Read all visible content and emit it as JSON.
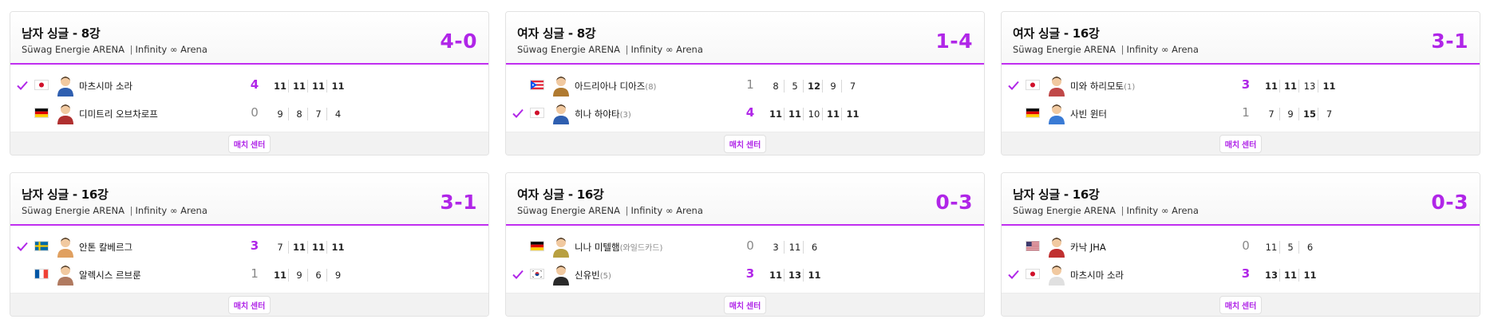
{
  "colors": {
    "accent": "#b026e8",
    "check": "#b026e8"
  },
  "match_center_label": "매치 센터",
  "matches": [
    {
      "title": "남자 싱글 - 8강",
      "venue": "Süwag Energie ARENA",
      "table": "Infinity ∞ Arena",
      "score": "4-0",
      "players": [
        {
          "name": "마츠시마 소라",
          "seed": "",
          "flag": "JPN",
          "winner": true,
          "sets": "4",
          "games": [
            "11",
            "11",
            "11",
            "11"
          ],
          "bold": [
            true,
            true,
            true,
            true
          ]
        },
        {
          "name": "디미트리 오브차로프",
          "seed": "",
          "flag": "GER",
          "winner": false,
          "sets": "0",
          "games": [
            "9",
            "8",
            "7",
            "4"
          ],
          "bold": [
            false,
            false,
            false,
            false
          ]
        }
      ]
    },
    {
      "title": "여자 싱글 - 8강",
      "venue": "Süwag Energie ARENA",
      "table": "Infinity ∞ Arena",
      "score": "1-4",
      "players": [
        {
          "name": "아드리아나 디아즈",
          "seed": "(8)",
          "flag": "PUR",
          "winner": false,
          "sets": "1",
          "games": [
            "8",
            "5",
            "12",
            "9",
            "7"
          ],
          "bold": [
            false,
            false,
            true,
            false,
            false
          ]
        },
        {
          "name": "히나 하야타",
          "seed": "(3)",
          "flag": "JPN",
          "winner": true,
          "sets": "4",
          "games": [
            "11",
            "11",
            "10",
            "11",
            "11"
          ],
          "bold": [
            true,
            true,
            false,
            true,
            true
          ]
        }
      ]
    },
    {
      "title": "여자 싱글 - 16강",
      "venue": "Süwag Energie ARENA",
      "table": "Infinity ∞ Arena",
      "score": "3-1",
      "players": [
        {
          "name": "미와 하리모토",
          "seed": "(1)",
          "flag": "JPN",
          "winner": true,
          "sets": "3",
          "games": [
            "11",
            "11",
            "13",
            "11"
          ],
          "bold": [
            true,
            true,
            false,
            true
          ]
        },
        {
          "name": "사빈 윈터",
          "seed": "",
          "flag": "GER",
          "winner": false,
          "sets": "1",
          "games": [
            "7",
            "9",
            "15",
            "7"
          ],
          "bold": [
            false,
            false,
            true,
            false
          ]
        }
      ]
    },
    {
      "title": "남자 싱글 - 16강",
      "venue": "Süwag Energie ARENA",
      "table": "Infinity ∞ Arena",
      "score": "3-1",
      "players": [
        {
          "name": "안톤 칼베르그",
          "seed": "",
          "flag": "SWE",
          "winner": true,
          "sets": "3",
          "games": [
            "7",
            "11",
            "11",
            "11"
          ],
          "bold": [
            false,
            true,
            true,
            true
          ]
        },
        {
          "name": "알렉시스 르브룬",
          "seed": "",
          "flag": "FRA",
          "winner": false,
          "sets": "1",
          "games": [
            "11",
            "9",
            "6",
            "9"
          ],
          "bold": [
            true,
            false,
            false,
            false
          ]
        }
      ]
    },
    {
      "title": "여자 싱글 - 16강",
      "venue": "Süwag Energie ARENA",
      "table": "Infinity ∞ Arena",
      "score": "0-3",
      "players": [
        {
          "name": "니나 미텔햄",
          "seed": "(와일드카드)",
          "flag": "GER",
          "winner": false,
          "sets": "0",
          "games": [
            "3",
            "11",
            "6"
          ],
          "bold": [
            false,
            false,
            false
          ]
        },
        {
          "name": "신유빈",
          "seed": "(5)",
          "flag": "KOR",
          "winner": true,
          "sets": "3",
          "games": [
            "11",
            "13",
            "11"
          ],
          "bold": [
            true,
            true,
            true
          ]
        }
      ]
    },
    {
      "title": "남자 싱글 - 16강",
      "venue": "Süwag Energie ARENA",
      "table": "Infinity ∞ Arena",
      "score": "0-3",
      "players": [
        {
          "name": "카낙 JHA",
          "seed": "",
          "flag": "USA",
          "winner": false,
          "sets": "0",
          "games": [
            "11",
            "5",
            "6"
          ],
          "bold": [
            false,
            false,
            false
          ]
        },
        {
          "name": "마츠시마 소라",
          "seed": "",
          "flag": "JPN",
          "winner": true,
          "sets": "3",
          "games": [
            "13",
            "11",
            "11"
          ],
          "bold": [
            true,
            true,
            true
          ]
        }
      ]
    }
  ]
}
